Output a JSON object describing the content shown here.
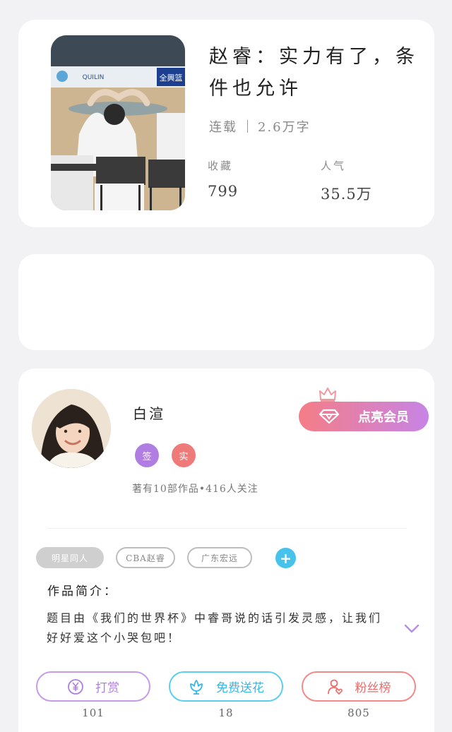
{
  "book": {
    "title": "赵睿：实力有了，条件也允许",
    "status": "连载",
    "word_count": "2.6万字",
    "favorites_label": "收藏",
    "favorites_value": "799",
    "popularity_label": "人气",
    "popularity_value": "35.5万",
    "cover_banner_text": "QUILIN",
    "cover_corner_text": "全興篮"
  },
  "author": {
    "name": "白渲",
    "badges": [
      "签",
      "实"
    ],
    "meta": "著有10部作品•416人关注",
    "vip_button": "点亮会员"
  },
  "work": {
    "tags": [
      "明星同人",
      "CBA赵睿",
      "广东宏远"
    ],
    "add_tag": "+",
    "intro_title": "作品简介：",
    "intro_text": "题目由《我们的世界杯》中睿哥说的话引发灵感，让我们好好爱这个小哭包吧！"
  },
  "actions": [
    {
      "label": "打赏",
      "count": "101"
    },
    {
      "label": "免费送花",
      "count": "18"
    },
    {
      "label": "粉丝榜",
      "count": "805"
    }
  ],
  "colors": {
    "background": "#f2f2f4",
    "vip_gradient_start": "#f57d86",
    "vip_gradient_end": "#c784e6",
    "reward": "#b07ee3",
    "flower": "#38b7e4",
    "fans": "#ea6d6d"
  }
}
